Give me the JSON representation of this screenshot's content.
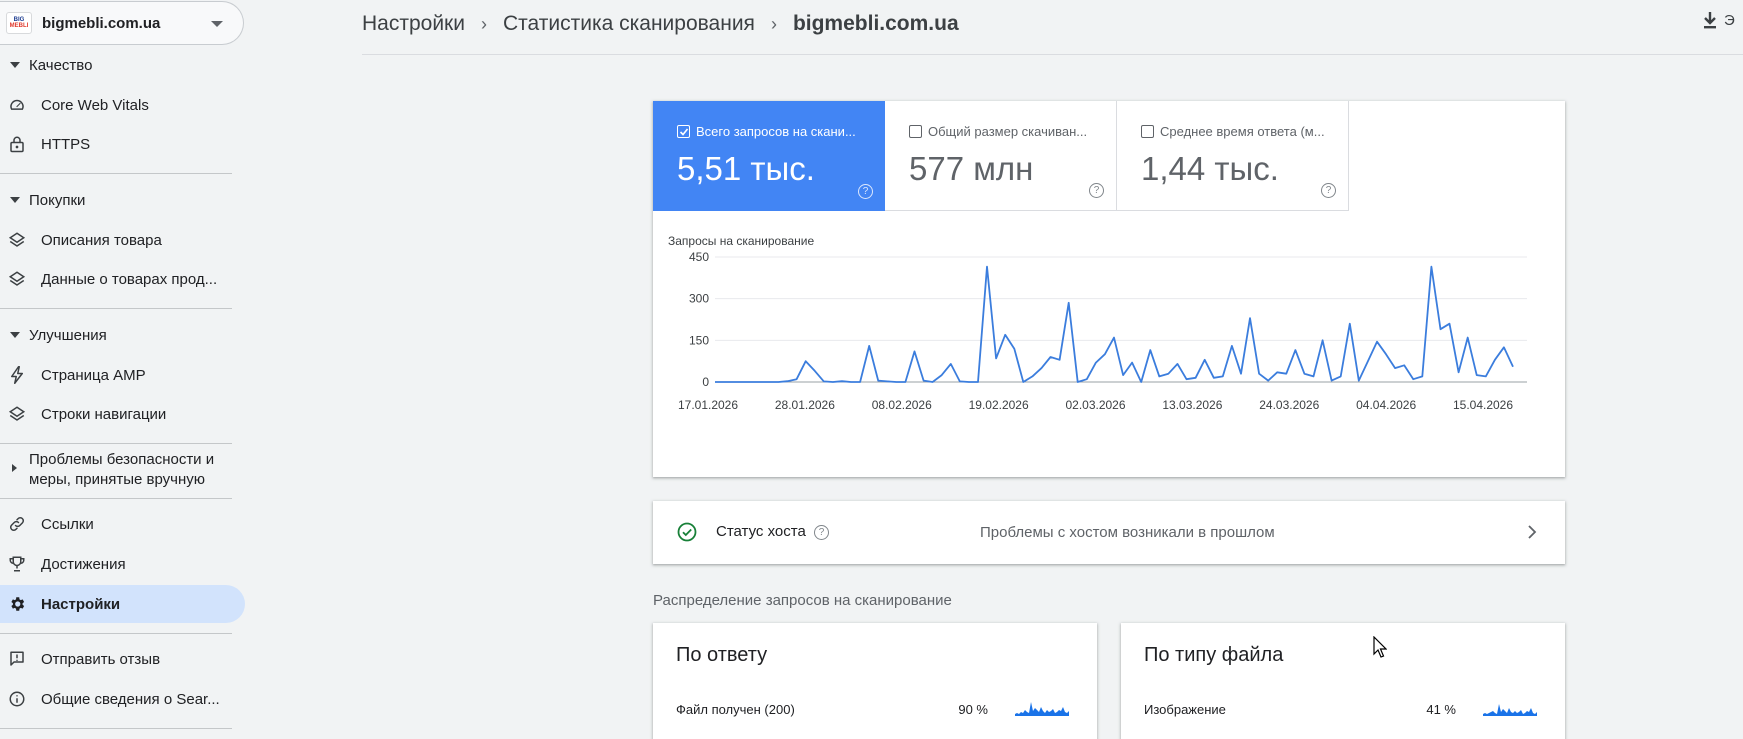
{
  "property": {
    "name": "bigmebli.com.ua",
    "favicon_top": "BIG",
    "favicon_bottom": "MEBLI"
  },
  "sidebar": {
    "sections": [
      {
        "title": "Качество",
        "items": [
          {
            "label": "Core Web Vitals",
            "icon": "speedometer-icon"
          },
          {
            "label": "HTTPS",
            "icon": "lock-icon"
          }
        ]
      },
      {
        "title": "Покупки",
        "items": [
          {
            "label": "Описания товара",
            "icon": "layers-icon"
          },
          {
            "label": "Данные о товарах прод...",
            "icon": "layers-icon"
          }
        ]
      },
      {
        "title": "Улучшения",
        "items": [
          {
            "label": "Страница AMP",
            "icon": "bolt-icon"
          },
          {
            "label": "Строки навигации",
            "icon": "layers-icon"
          }
        ]
      }
    ],
    "security": {
      "line1": "Проблемы безопасности и",
      "line2": "меры, принятые вручную"
    },
    "links": [
      {
        "label": "Ссылки",
        "icon": "link-icon"
      },
      {
        "label": "Достижения",
        "icon": "trophy-icon"
      },
      {
        "label": "Настройки",
        "icon": "gear-icon",
        "active": true
      }
    ],
    "footer": [
      {
        "label": "Отправить отзыв",
        "icon": "feedback-icon"
      },
      {
        "label": "Общие сведения о Sear...",
        "icon": "info-icon"
      }
    ]
  },
  "breadcrumb": {
    "items": [
      "Настройки",
      "Статистика сканирования"
    ],
    "current": "bigmebli.com.ua",
    "separator": "›"
  },
  "export": {
    "label": "Э"
  },
  "metrics": [
    {
      "label": "Всего запросов на скани...",
      "value": "5,51 тыс.",
      "selected": true
    },
    {
      "label": "Общий размер скачиван...",
      "value": "577 млн",
      "selected": false
    },
    {
      "label": "Среднее время ответа (м...",
      "value": "1,44 тыс.",
      "selected": false
    }
  ],
  "colors": {
    "accent": "#4285f4",
    "line": "#3b7ddd",
    "ok": "#188038",
    "active_nav": "#d2e3fc"
  },
  "chart_data": {
    "type": "line",
    "title": "Запросы на сканирование",
    "ylim": [
      0,
      450
    ],
    "yticks": [
      0,
      150,
      300,
      450
    ],
    "xtick_labels": [
      "17.01.2026",
      "28.01.2026",
      "08.02.2026",
      "19.02.2026",
      "02.03.2026",
      "13.03.2026",
      "24.03.2026",
      "04.04.2026",
      "15.04.2026"
    ],
    "x_start": "17.01.2026",
    "series": [
      {
        "values": [
          0,
          0,
          0,
          0,
          0,
          0,
          0,
          0,
          3,
          10,
          75,
          40,
          2,
          0,
          3,
          0,
          0,
          130,
          5,
          2,
          0,
          0,
          110,
          5,
          0,
          25,
          65,
          2,
          0,
          0,
          415,
          85,
          170,
          120,
          0,
          20,
          50,
          90,
          80,
          285,
          0,
          10,
          70,
          100,
          160,
          25,
          70,
          0,
          115,
          20,
          30,
          65,
          10,
          15,
          80,
          15,
          20,
          130,
          30,
          230,
          30,
          5,
          35,
          30,
          115,
          30,
          20,
          150,
          5,
          20,
          210,
          5,
          75,
          145,
          100,
          50,
          60,
          10,
          20,
          415,
          190,
          210,
          35,
          160,
          25,
          20,
          80,
          125,
          55
        ]
      }
    ]
  },
  "host_status": {
    "title": "Статус хоста",
    "desc": "Проблемы с хостом возникали в прошлом"
  },
  "distribution": {
    "title": "Распределение запросов на сканирование",
    "cards": [
      {
        "title": "По ответу",
        "row_label": "Файл получен (200)",
        "row_pct": "90 %"
      },
      {
        "title": "По типу файла",
        "row_label": "Изображение",
        "row_pct": "41 %"
      }
    ]
  }
}
